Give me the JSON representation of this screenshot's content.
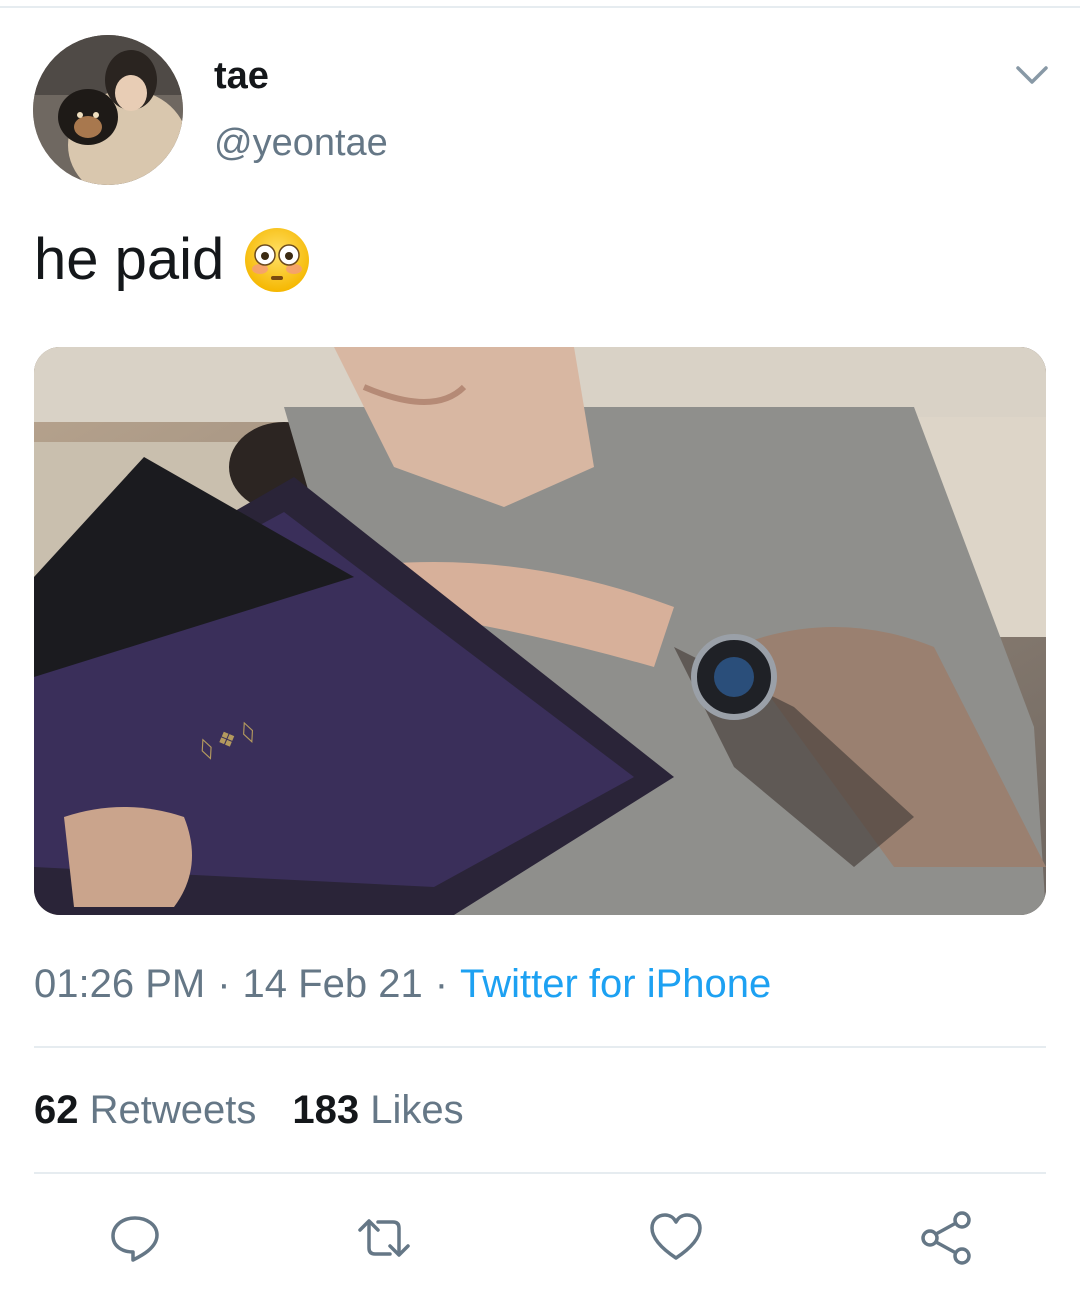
{
  "tweet": {
    "display_name": "tae",
    "handle": "@yeontae",
    "text": "he paid",
    "emoji": "flushed-face-emoji",
    "time": "01:26 PM",
    "date": "14 Feb 21",
    "separator": "·",
    "source": "Twitter for iPhone"
  },
  "stats": {
    "retweets_count": "62",
    "retweets_label": "Retweets",
    "likes_count": "183",
    "likes_label": "Likes"
  },
  "actions": [
    "reply-icon",
    "retweet-icon",
    "like-icon",
    "share-icon"
  ],
  "colors": {
    "text": "#14171a",
    "muted": "#657786",
    "accent": "#1da1f2",
    "divider": "#e6ecf0"
  }
}
